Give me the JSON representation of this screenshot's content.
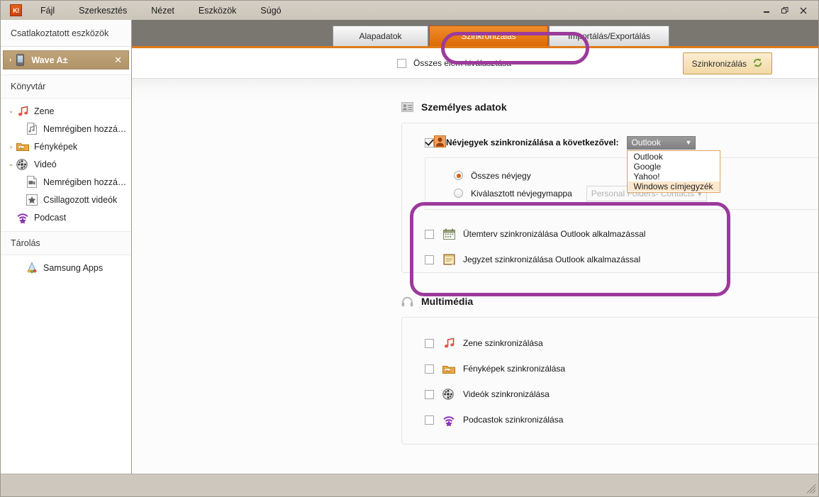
{
  "window": {
    "app_logo_text": "K!",
    "minimize": "minimize-icon",
    "maximize": "restore-icon",
    "close": "close-icon"
  },
  "menubar": {
    "items": [
      {
        "label": "Fájl"
      },
      {
        "label": "Szerkesztés"
      },
      {
        "label": "Nézet"
      },
      {
        "label": "Eszközök"
      },
      {
        "label": "Súgó"
      }
    ]
  },
  "sidebar": {
    "header": "Csatlakoztatott eszközök",
    "device": {
      "name": "Wave A±",
      "expand_arrow": "›",
      "close": "✕"
    },
    "library_section": "Könyvtár",
    "library_items": [
      {
        "label": "Zene",
        "twist": "⌄",
        "icon": "music-note-icon",
        "child": false
      },
      {
        "label": "Nemrégiben hozzá…",
        "twist": "",
        "icon": "recent-music-icon",
        "child": true
      },
      {
        "label": "Fényképek",
        "twist": "›",
        "icon": "photos-folder-icon",
        "child": false
      },
      {
        "label": "Videó",
        "twist": "⌄",
        "icon": "film-reel-icon",
        "child": false
      },
      {
        "label": "Nemrégiben hozzá…",
        "twist": "",
        "icon": "recent-video-icon",
        "child": true
      },
      {
        "label": "Csillagozott videók",
        "twist": "",
        "icon": "star-icon",
        "child": true
      },
      {
        "label": "Podcast",
        "twist": "",
        "icon": "podcast-icon",
        "child": false
      }
    ],
    "storage_section": "Tárolás",
    "storage_items": [
      {
        "label": "Samsung Apps",
        "icon": "samsung-apps-icon"
      }
    ]
  },
  "tabs": [
    {
      "label": "Alapadatok",
      "active": false
    },
    {
      "label": "Szinkronizálás",
      "active": true
    },
    {
      "label": "Importálás/Exportálás",
      "active": false
    }
  ],
  "toolbar": {
    "select_all_label": "Összes elem kiválasztása",
    "select_all_checked": false,
    "sync_button_label": "Szinkronizálás",
    "sync_button_icon": "refresh-icon"
  },
  "sections": [
    {
      "title": "Személyes adatok",
      "icon": "contact-card-icon"
    },
    {
      "title": "Multimédia",
      "icon": "headphones-icon"
    }
  ],
  "personal": {
    "contacts": {
      "checked": true,
      "icon": "contact-avatar-icon",
      "label": "Névjegyek szinkronizálása a következővel:",
      "combo": {
        "value": "Outlook",
        "expanded": true,
        "options": [
          {
            "label": "Outlook",
            "selected": false
          },
          {
            "label": "Google",
            "selected": false
          },
          {
            "label": "Yahoo!",
            "selected": false
          },
          {
            "label": "Windows címjegyzék",
            "selected": true
          }
        ]
      },
      "radios": [
        {
          "label": "Összes névjegy",
          "selected": true
        },
        {
          "label": "Kiválasztott névjegymappa",
          "selected": false
        }
      ],
      "folder_field": {
        "value": "Personal Folders- Contacts",
        "enabled": false,
        "carat": "▾"
      }
    },
    "other_rows": [
      {
        "label": "Ütemterv szinkronizálása Outlook alkalmazással",
        "checked": false,
        "icon": "calendar-icon"
      },
      {
        "label": "Jegyzet szinkronizálása Outlook alkalmazással",
        "checked": false,
        "icon": "note-icon"
      }
    ]
  },
  "multimedia": {
    "rows": [
      {
        "label": "Zene szinkronizálása",
        "checked": false,
        "icon": "music-note-icon"
      },
      {
        "label": "Fényképek szinkronizálása",
        "checked": false,
        "icon": "photos-folder-icon"
      },
      {
        "label": "Videók szinkronizálása",
        "checked": false,
        "icon": "film-reel-icon"
      },
      {
        "label": "Podcastok szinkronizálása",
        "checked": false,
        "icon": "podcast-icon"
      }
    ]
  },
  "annotations": {
    "highlight_color": "#9c3a9c",
    "rings": [
      {
        "target": "tab-szinkronizalas"
      },
      {
        "target": "contacts-sync-block"
      }
    ]
  }
}
